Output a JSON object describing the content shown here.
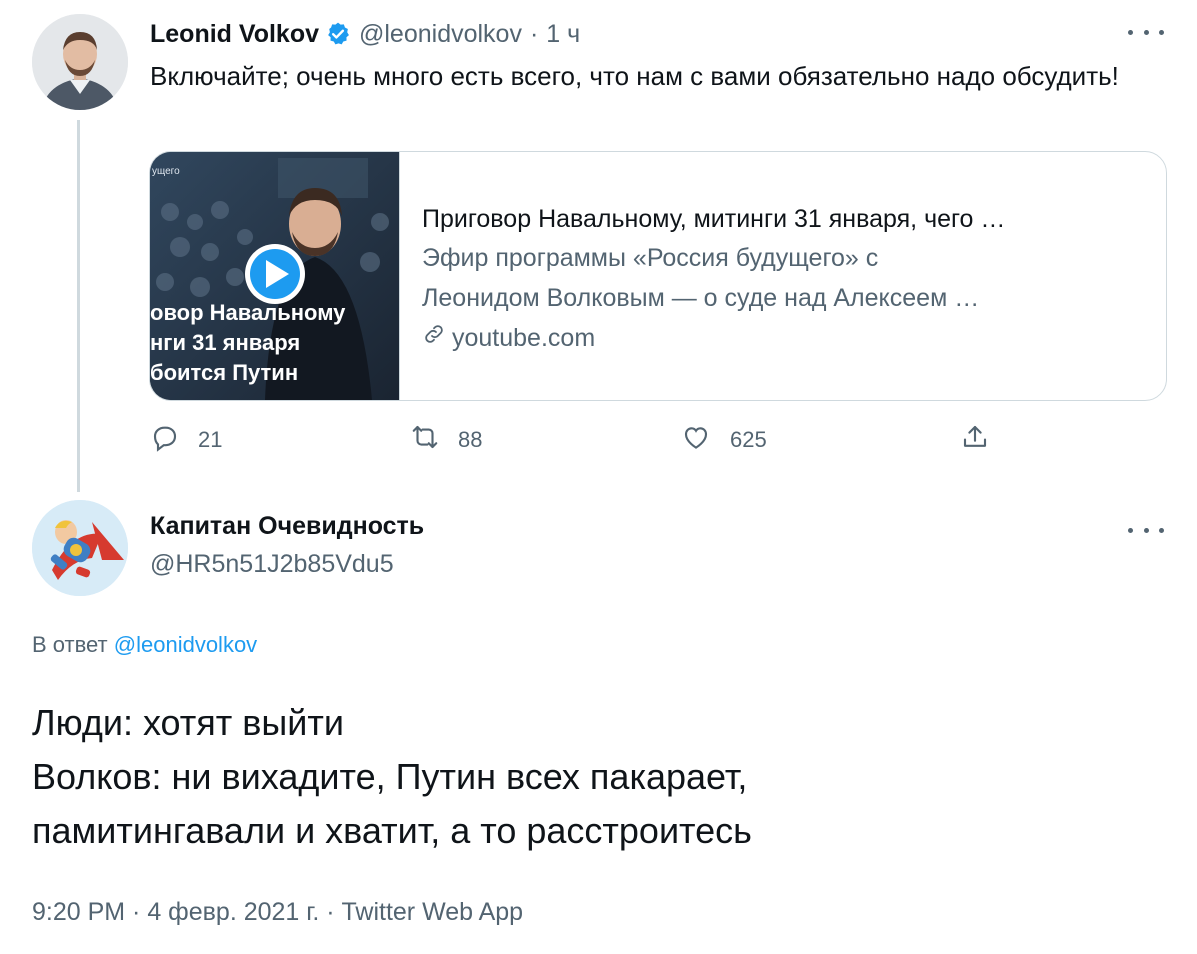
{
  "tweet1": {
    "author_name": "Leonid Volkov",
    "handle": "@leonidvolkov",
    "separator": "·",
    "time": "1 ч",
    "text": "Включайте; очень много есть всего, что нам с вами обязательно надо обсудить!",
    "card": {
      "thumb_lines": [
        "овор Навальному",
        "нги 31 января",
        "боится Путин"
      ],
      "thumb_top": "ущего",
      "title": "Приговор Навальному, митинги 31 января, чего …",
      "desc_line1": "Эфир программы «Россия будущего» с",
      "desc_line2": "Леонидом Волковым — о суде над Алексеем …",
      "domain": "youtube.com"
    },
    "actions": {
      "replies": "21",
      "retweets": "88",
      "likes": "625"
    }
  },
  "tweet2": {
    "author_name": "Капитан Очевидность",
    "handle": "@HR5n51J2b85Vdu5",
    "replying_prefix": "В ответ",
    "replying_handle": "@leonidvolkov",
    "text_line1": "Люди: хотят выйти",
    "text_line2": "Волков: ни вихадите, Путин всех пакарает,",
    "text_line3": "памитингавали и хватит, а то расстроитесь",
    "meta": "9:20 PM · 4 февр. 2021 г. · Twitter Web App"
  },
  "colors": {
    "accent": "#1d9bf0",
    "secondary_text": "#536471",
    "border": "#cfd9de"
  }
}
